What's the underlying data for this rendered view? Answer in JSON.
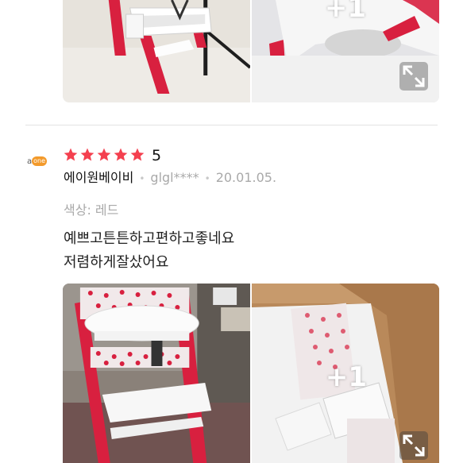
{
  "colors": {
    "star": "#f4404f",
    "chair_red": "#d8203f",
    "plus_text": "#ffffff",
    "avatar_badge": "#f39a2b"
  },
  "review_prev": {
    "photo_more_count": "+1",
    "expand_icon": "expand-arrows-icon"
  },
  "review": {
    "avatar": {
      "a": "a",
      "one": "one"
    },
    "stars_filled": 5,
    "rating": "5",
    "nickname": "에이원베이비",
    "user_id": "glgl****",
    "date": "20.01.05.",
    "option": "색상: 레드",
    "text_lines": [
      "예쁘고튼튼하고편하고좋네요",
      "저렴하게잘샀어요"
    ],
    "photo_more_count": "+1",
    "expand_icon": "expand-arrows-icon"
  }
}
